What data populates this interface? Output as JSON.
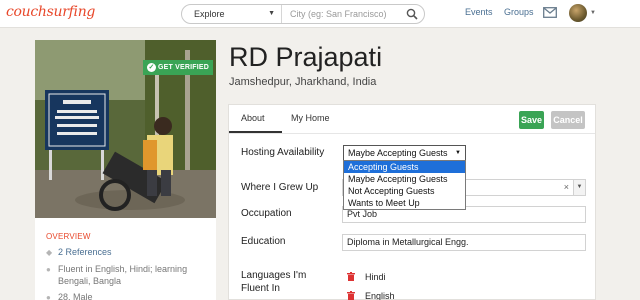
{
  "header": {
    "logo": "couchsurfing",
    "search": {
      "explore_value": "Explore",
      "city_placeholder": "City (eg: San Francisco)"
    },
    "nav": {
      "events": "Events",
      "groups": "Groups"
    }
  },
  "profile": {
    "verified_badge": "GET VERIFIED",
    "name": "RD Prajapati",
    "location": "Jamshedpur, Jharkhand, India"
  },
  "sidebar": {
    "overview": "OVERVIEW",
    "references": "2 References",
    "languages_line1": "Fluent in English, Hindi; learning",
    "languages_line2": "Bengali, Bangla",
    "age_gender": "28, Male"
  },
  "panel": {
    "tabs": [
      "About",
      "My Home"
    ],
    "save": "Save",
    "cancel": "Cancel",
    "hosting": {
      "label": "Hosting Availability",
      "selected": "Maybe Accepting Guests",
      "options": [
        "Accepting Guests",
        "Maybe Accepting Guests",
        "Not Accepting Guests",
        "Wants to Meet Up"
      ],
      "highlighted_index": 0
    },
    "grew_up": {
      "label": "Where I Grew Up",
      "clear": "×"
    },
    "occupation": {
      "label": "Occupation",
      "value": "Pvt Job"
    },
    "education": {
      "label": "Education",
      "value": "Diploma in Metallurgical Engg."
    },
    "languages": {
      "label_line1": "Languages I'm",
      "label_line2": "Fluent In",
      "items": [
        "Hindi",
        "English"
      ]
    }
  },
  "colors": {
    "brand": "#e8482b",
    "link": "#4a6f92",
    "save": "#3aa455",
    "cancel": "#c4c4c4",
    "dropdown_highlight": "#1e6fd9"
  },
  "icons": [
    "search-icon",
    "mail-icon",
    "check-icon",
    "chevron-down-icon",
    "references-icon",
    "speech-icon",
    "user-icon",
    "trash-icon"
  ]
}
